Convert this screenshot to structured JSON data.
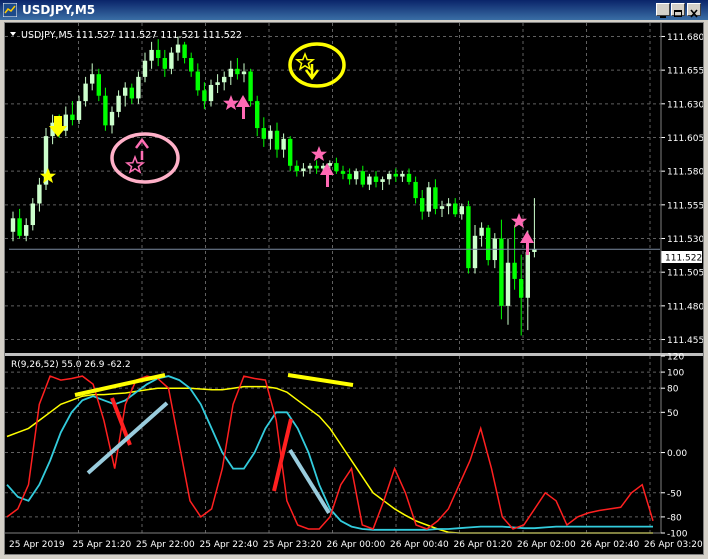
{
  "window": {
    "title": "USDJPY,M5"
  },
  "price_panel": {
    "header": "USDJPY,M5  111.527 111.527 111.521 111.522",
    "current_price": "111.522",
    "price_min": 111.445,
    "price_max": 111.69,
    "price_ticks": [
      "111.680",
      "111.655",
      "111.630",
      "111.605",
      "111.580",
      "111.555",
      "111.530",
      "111.505",
      "111.480",
      "111.455"
    ]
  },
  "indicator_panel": {
    "header": "R(9,26,52) 55.0 26.9 -62.2",
    "ticks": [
      "120",
      "100",
      "80",
      "50",
      "0.00",
      "-50",
      "-80",
      "-100"
    ]
  },
  "time_axis": [
    "25 Apr 2019",
    "25 Apr 21:20",
    "25 Apr 22:00",
    "25 Apr 22:40",
    "25 Apr 23:20",
    "26 Apr 00:00",
    "26 Apr 00:40",
    "26 Apr 01:20",
    "26 Apr 02:00",
    "26 Apr 02:40",
    "26 Apr 03:20"
  ],
  "colors": {
    "bull": "#ccffcc",
    "bear": "#00ff00",
    "grid": "#606060",
    "red": "#ff2020",
    "cyan": "#33ccdd",
    "yellow": "#ffff00",
    "pink": "#ff69b4",
    "lightblue": "#99ccdd"
  },
  "chart_data": {
    "type": "candlestick",
    "symbol": "USDJPY",
    "timeframe": "M5",
    "ohlc": [
      [
        111.535,
        111.55,
        111.528,
        111.545
      ],
      [
        111.545,
        111.552,
        111.53,
        111.532
      ],
      [
        111.532,
        111.545,
        111.528,
        111.54
      ],
      [
        111.54,
        111.56,
        111.536,
        111.556
      ],
      [
        111.556,
        111.575,
        111.55,
        111.57
      ],
      [
        111.57,
        111.612,
        111.566,
        111.606
      ],
      [
        111.606,
        111.622,
        111.6,
        111.616
      ],
      [
        111.616,
        111.622,
        111.605,
        111.61
      ],
      [
        111.61,
        111.628,
        111.606,
        111.622
      ],
      [
        111.622,
        111.632,
        111.614,
        111.618
      ],
      [
        111.618,
        111.636,
        111.615,
        111.632
      ],
      [
        111.632,
        111.65,
        111.628,
        111.645
      ],
      [
        111.645,
        111.66,
        111.64,
        111.652
      ],
      [
        111.652,
        111.656,
        111.632,
        111.636
      ],
      [
        111.636,
        111.642,
        111.61,
        111.614
      ],
      [
        111.614,
        111.628,
        111.608,
        111.624
      ],
      [
        111.624,
        111.64,
        111.62,
        111.636
      ],
      [
        111.636,
        111.646,
        111.628,
        111.642
      ],
      [
        111.642,
        111.645,
        111.63,
        111.634
      ],
      [
        111.634,
        111.654,
        111.63,
        111.65
      ],
      [
        111.65,
        111.668,
        111.646,
        111.662
      ],
      [
        111.662,
        111.676,
        111.656,
        111.67
      ],
      [
        111.67,
        111.678,
        111.658,
        111.664
      ],
      [
        111.664,
        111.67,
        111.65,
        111.656
      ],
      [
        111.656,
        111.672,
        111.652,
        111.668
      ],
      [
        111.668,
        111.68,
        111.662,
        111.674
      ],
      [
        111.674,
        111.676,
        111.66,
        111.664
      ],
      [
        111.664,
        111.668,
        111.65,
        111.654
      ],
      [
        111.654,
        111.66,
        111.636,
        111.64
      ],
      [
        111.64,
        111.646,
        111.626,
        111.632
      ],
      [
        111.632,
        111.648,
        111.628,
        111.644
      ],
      [
        111.644,
        111.652,
        111.638,
        111.646
      ],
      [
        111.646,
        111.654,
        111.64,
        111.65
      ],
      [
        111.65,
        111.662,
        111.644,
        111.656
      ],
      [
        111.656,
        111.664,
        111.648,
        111.652
      ],
      [
        111.652,
        111.66,
        111.646,
        111.654
      ],
      [
        111.654,
        111.656,
        111.628,
        111.632
      ],
      [
        111.632,
        111.636,
        111.606,
        111.612
      ],
      [
        111.612,
        111.62,
        111.598,
        111.604
      ],
      [
        111.604,
        111.614,
        111.596,
        111.61
      ],
      [
        111.61,
        111.616,
        111.59,
        111.596
      ],
      [
        111.596,
        111.608,
        111.59,
        111.604
      ],
      [
        111.604,
        111.606,
        111.58,
        111.584
      ],
      [
        111.584,
        111.588,
        111.576,
        111.58
      ],
      [
        111.58,
        111.586,
        111.576,
        111.582
      ],
      [
        111.582,
        111.586,
        111.578,
        111.584
      ],
      [
        111.584,
        111.588,
        111.578,
        111.582
      ],
      [
        111.582,
        111.586,
        111.578,
        111.584
      ],
      [
        111.584,
        111.588,
        111.58,
        111.586
      ],
      [
        111.586,
        111.59,
        111.578,
        111.58
      ],
      [
        111.58,
        111.584,
        111.574,
        111.578
      ],
      [
        111.578,
        111.582,
        111.57,
        111.574
      ],
      [
        111.574,
        111.582,
        111.57,
        111.58
      ],
      [
        111.58,
        111.584,
        111.568,
        111.57
      ],
      [
        111.57,
        111.578,
        111.566,
        111.576
      ],
      [
        111.576,
        111.58,
        111.568,
        111.572
      ],
      [
        111.572,
        111.576,
        111.566,
        111.574
      ],
      [
        111.574,
        111.58,
        111.57,
        111.578
      ],
      [
        111.578,
        111.582,
        111.572,
        111.576
      ],
      [
        111.576,
        111.58,
        111.572,
        111.578
      ],
      [
        111.578,
        111.582,
        111.57,
        111.572
      ],
      [
        111.572,
        111.576,
        111.556,
        111.56
      ],
      [
        111.56,
        111.566,
        111.544,
        111.55
      ],
      [
        111.55,
        111.572,
        111.546,
        111.568
      ],
      [
        111.568,
        111.574,
        111.548,
        111.552
      ],
      [
        111.552,
        111.558,
        111.546,
        111.554
      ],
      [
        111.554,
        111.56,
        111.548,
        111.556
      ],
      [
        111.556,
        111.56,
        111.546,
        111.548
      ],
      [
        111.548,
        111.556,
        111.544,
        111.554
      ],
      [
        111.554,
        111.558,
        111.504,
        111.508
      ],
      [
        111.508,
        111.54,
        111.504,
        111.532
      ],
      [
        111.532,
        111.542,
        111.524,
        111.538
      ],
      [
        111.538,
        111.54,
        111.51,
        111.514
      ],
      [
        111.514,
        111.534,
        111.508,
        111.53
      ],
      [
        111.53,
        111.544,
        111.47,
        111.48
      ],
      [
        111.48,
        111.53,
        111.466,
        111.512
      ],
      [
        111.512,
        111.54,
        111.492,
        111.5
      ],
      [
        111.5,
        111.518,
        111.458,
        111.486
      ],
      [
        111.486,
        111.536,
        111.462,
        111.52
      ],
      [
        111.52,
        111.56,
        111.516,
        111.522
      ]
    ],
    "indicator": {
      "name": "R(9,26,52)",
      "ylim": [
        -100,
        120
      ],
      "series": [
        {
          "name": "9",
          "color": "red",
          "values": [
            -80,
            -70,
            -40,
            60,
            95,
            90,
            92,
            95,
            85,
            40,
            -20,
            60,
            90,
            95,
            92,
            80,
            10,
            -60,
            -80,
            -70,
            -20,
            60,
            95,
            92,
            90,
            40,
            -60,
            -90,
            -95,
            -95,
            -80,
            -40,
            -20,
            -90,
            -95,
            -60,
            -20,
            -50,
            -90,
            -95,
            -85,
            -70,
            -40,
            -10,
            30,
            -20,
            -80,
            -95,
            -90,
            -70,
            -50,
            -60,
            -90,
            -80,
            -75,
            -72,
            -70,
            -68,
            -50,
            -40,
            -85
          ]
        },
        {
          "name": "26",
          "color": "cyan",
          "values": [
            -40,
            -55,
            -60,
            -40,
            -10,
            25,
            50,
            65,
            70,
            65,
            60,
            65,
            75,
            85,
            92,
            95,
            90,
            80,
            60,
            30,
            0,
            -20,
            -20,
            0,
            30,
            50,
            50,
            30,
            0,
            -40,
            -70,
            -85,
            -92,
            -95,
            -96,
            -96,
            -96,
            -96,
            -96,
            -96,
            -95,
            -95,
            -94,
            -93,
            -92,
            -92,
            -92,
            -93,
            -94,
            -94,
            -93,
            -92,
            -92,
            -92,
            -92,
            -92,
            -92,
            -92,
            -92,
            -92,
            -92
          ]
        },
        {
          "name": "52",
          "color": "yellow",
          "values": [
            20,
            25,
            30,
            40,
            50,
            60,
            65,
            70,
            72,
            72,
            73,
            74,
            76,
            78,
            80,
            80,
            80,
            80,
            79,
            78,
            78,
            80,
            82,
            82,
            82,
            80,
            75,
            65,
            55,
            45,
            30,
            10,
            -10,
            -30,
            -50,
            -60,
            -70,
            -78,
            -85,
            -90,
            -95,
            -99,
            -102,
            -105,
            -108,
            -110,
            -112,
            -113,
            -114,
            -115,
            -115,
            -115,
            -115,
            -115,
            -115,
            -115,
            -115,
            -115,
            -115,
            -115,
            -115
          ]
        }
      ]
    }
  }
}
